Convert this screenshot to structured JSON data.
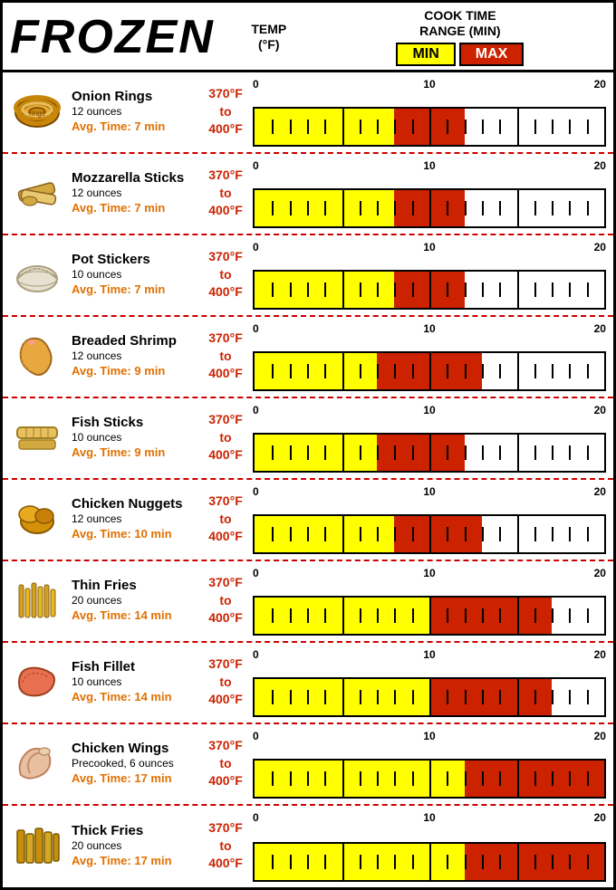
{
  "header": {
    "title": "FROZEN",
    "temp_label": "TEMP\n(°F)",
    "cook_label": "COOK TIME\nRANGE (MIN)",
    "min_label": "MIN",
    "max_label": "MAX"
  },
  "foods": [
    {
      "name": "Onion Rings",
      "weight": "12 ounces",
      "avg": "Avg. Time: 7 min",
      "temp": "370°F\nto\n400°F",
      "min_val": 8,
      "max_val": 12,
      "food_type": "onion-rings"
    },
    {
      "name": "Mozzarella Sticks",
      "weight": "12 ounces",
      "avg": "Avg. Time: 7 min",
      "temp": "370°F\nto\n400°F",
      "min_val": 8,
      "max_val": 12,
      "food_type": "mozzarella-sticks"
    },
    {
      "name": "Pot Stickers",
      "weight": "10 ounces",
      "avg": "Avg. Time: 7 min",
      "temp": "370°F\nto\n400°F",
      "min_val": 8,
      "max_val": 12,
      "food_type": "pot-stickers"
    },
    {
      "name": "Breaded Shrimp",
      "weight": "12 ounces",
      "avg": "Avg. Time: 9 min",
      "temp": "370°F\nto\n400°F",
      "min_val": 7,
      "max_val": 13,
      "food_type": "breaded-shrimp"
    },
    {
      "name": "Fish Sticks",
      "weight": "10 ounces",
      "avg": "Avg. Time: 9 min",
      "temp": "370°F\nto\n400°F",
      "min_val": 7,
      "max_val": 12,
      "food_type": "fish-sticks"
    },
    {
      "name": "Chicken Nuggets",
      "weight": "12 ounces",
      "avg": "Avg. Time: 10 min",
      "temp": "370°F\nto\n400°F",
      "min_val": 8,
      "max_val": 13,
      "food_type": "chicken-nuggets"
    },
    {
      "name": "Thin Fries",
      "weight": "20 ounces",
      "avg": "Avg. Time: 14 min",
      "temp": "370°F\nto\n400°F",
      "min_val": 10,
      "max_val": 17,
      "food_type": "thin-fries"
    },
    {
      "name": "Fish Fillet",
      "weight": "10 ounces",
      "avg": "Avg. Time: 14 min",
      "temp": "370°F\nto\n400°F",
      "min_val": 10,
      "max_val": 17,
      "food_type": "fish-fillet"
    },
    {
      "name": "Chicken Wings",
      "weight": "Precooked, 6 ounces",
      "avg": "Avg. Time: 17 min",
      "temp": "370°F\nto\n400°F",
      "min_val": 12,
      "max_val": 20,
      "food_type": "chicken-wings"
    },
    {
      "name": "Thick Fries",
      "weight": "20 ounces",
      "avg": "Avg. Time: 17 min",
      "temp": "370°F\nto\n400°F",
      "min_val": 12,
      "max_val": 20,
      "food_type": "thick-fries"
    }
  ],
  "chart": {
    "min_label": "0",
    "mid_label": "10",
    "max_label": "20",
    "total": 20
  }
}
